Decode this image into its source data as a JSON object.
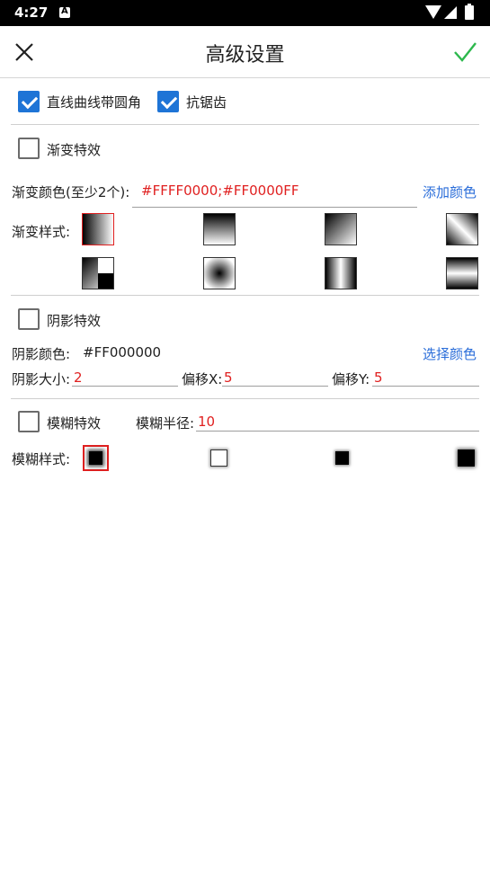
{
  "status_bar": {
    "time": "4:27"
  },
  "appbar": {
    "title": "高级设置"
  },
  "options": {
    "round_corner": {
      "label": "直线曲线带圆角",
      "checked": true
    },
    "antialias": {
      "label": "抗锯齿",
      "checked": true
    }
  },
  "gradient": {
    "enable_label": "渐变特效",
    "enabled": false,
    "colors_label": "渐变颜色(至少2个):",
    "colors_value": "#FFFF0000;#FF0000FF",
    "add_color_link": "添加颜色",
    "style_label": "渐变样式:",
    "selected_style_index": 0
  },
  "shadow": {
    "enable_label": "阴影特效",
    "enabled": false,
    "color_label": "阴影颜色:",
    "color_value": "#FF000000",
    "choose_color_link": "选择颜色",
    "size_label": "阴影大小:",
    "size_value": "2",
    "offset_x_label": "偏移X:",
    "offset_x_value": "5",
    "offset_y_label": "偏移Y:",
    "offset_y_value": "5"
  },
  "blur": {
    "enable_label": "模糊特效",
    "enabled": false,
    "radius_label": "模糊半径:",
    "radius_value": "10",
    "style_label": "模糊样式:",
    "selected_style_index": 0
  },
  "colors": {
    "accent": "#1e74d6",
    "confirm": "#2db84d",
    "value_text": "#e02020",
    "link": "#2a6dd9"
  }
}
